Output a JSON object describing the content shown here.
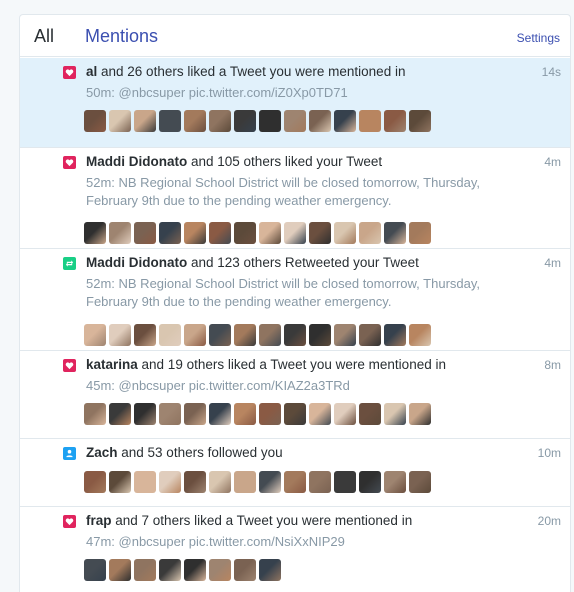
{
  "tabs": {
    "all": "All",
    "mentions": "Mentions",
    "settings": "Settings"
  },
  "notifications": [
    {
      "type": "like",
      "icon": "heart-icon",
      "actor": "al",
      "action": " and 26 others liked a Tweet you were mentioned in",
      "time": "14s",
      "snippet": "50m: @nbcsuper pic.twitter.com/iZ0Xp0TD71",
      "unread": true,
      "avatar_count": 14
    },
    {
      "type": "like",
      "icon": "heart-icon",
      "actor": "Maddi Didonato",
      "action": " and 105 others liked your Tweet",
      "time": "4m",
      "snippet": "52m: NB Regional School District will be closed tomorrow, Thursday, February 9th due to the pending weather emergency.",
      "unread": false,
      "avatar_count": 14
    },
    {
      "type": "retweet",
      "icon": "retweet-icon",
      "actor": "Maddi Didonato",
      "action": " and 123 others Retweeted your Tweet",
      "time": "4m",
      "snippet": "52m: NB Regional School District will be closed tomorrow, Thursday, February 9th due to the pending weather emergency.",
      "unread": false,
      "avatar_count": 14
    },
    {
      "type": "like",
      "icon": "heart-icon",
      "actor": "katarina",
      "action": " and 19 others liked a Tweet you were mentioned in",
      "time": "8m",
      "snippet": "45m: @nbcsuper pic.twitter.com/KIAZ2a3TRd",
      "unread": false,
      "avatar_count": 14
    },
    {
      "type": "follow",
      "icon": "person-icon",
      "actor": "Zach",
      "action": " and 53 others followed you",
      "time": "10m",
      "snippet": "",
      "unread": false,
      "avatar_count": 14
    },
    {
      "type": "like",
      "icon": "heart-icon",
      "actor": "frap",
      "action": " and 7 others liked a Tweet you were mentioned in",
      "time": "20m",
      "snippet": "47m: @nbcsuper pic.twitter.com/NsiXxNIP29",
      "unread": false,
      "avatar_count": 8
    }
  ]
}
